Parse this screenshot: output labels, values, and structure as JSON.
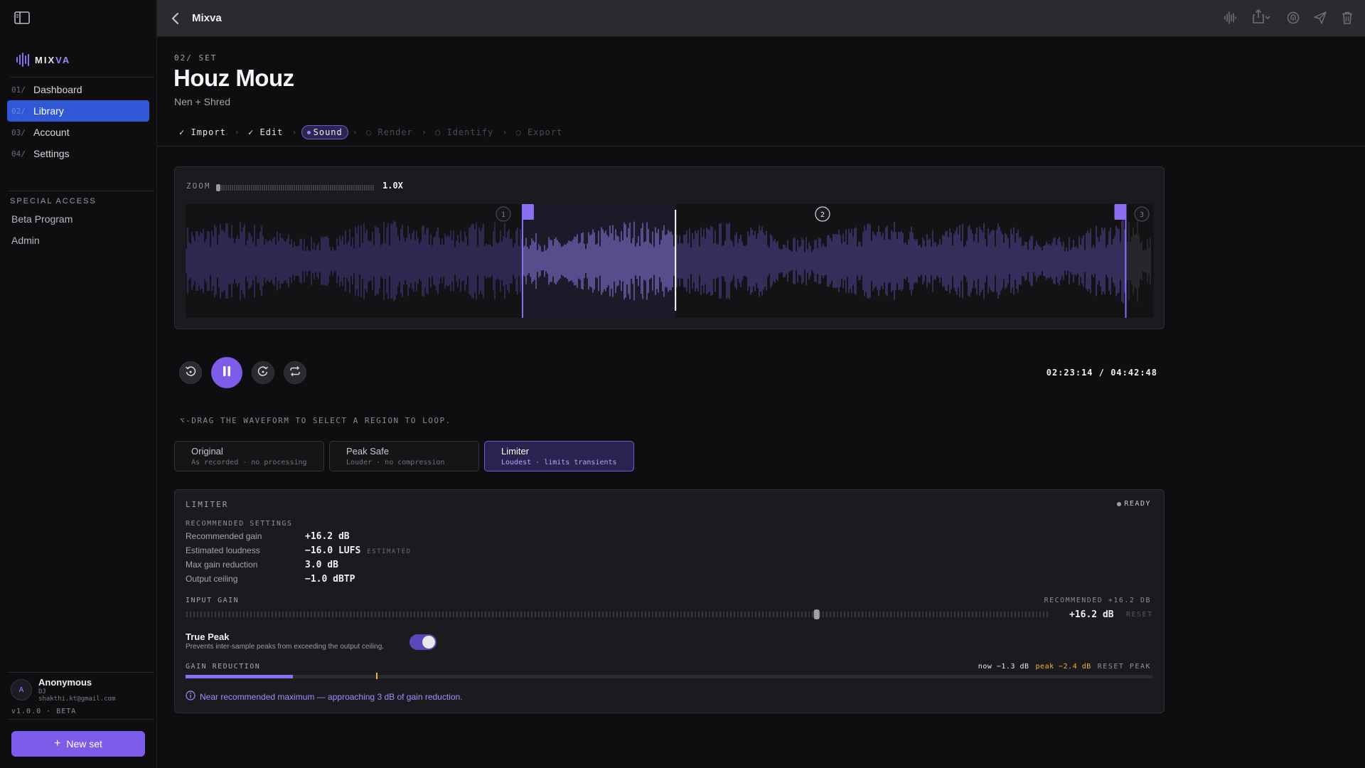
{
  "app": {
    "title": "Mixva"
  },
  "sidebar": {
    "logo_a": "MIX",
    "logo_b": "VA",
    "nav": [
      {
        "num": "01/",
        "label": "Dashboard",
        "active": false
      },
      {
        "num": "02/",
        "label": "Library",
        "active": true
      },
      {
        "num": "03/",
        "label": "Account",
        "active": false
      },
      {
        "num": "04/",
        "label": "Settings",
        "active": false
      }
    ],
    "special_title": "SPECIAL ACCESS",
    "special_items": [
      "Beta Program",
      "Admin"
    ],
    "user": {
      "initial": "A",
      "name": "Anonymous",
      "role": "DJ",
      "email": "shakthi.kt@gmail.com"
    },
    "version": "v1.0.0 · BETA",
    "new_set": "New set"
  },
  "topbar": {
    "title": "Mixva",
    "icons": [
      "waveform-icon",
      "share-icon",
      "chevron-down-icon",
      "fingerprint-icon",
      "send-icon",
      "trash-icon"
    ]
  },
  "set": {
    "kicker": "02/ SET",
    "title": "Houz Mouz",
    "subtitle": "Nen + Shred"
  },
  "steps": [
    {
      "label": "✓ Import",
      "state": "done"
    },
    {
      "label": "✓ Edit",
      "state": "done"
    },
    {
      "label": "Sound",
      "state": "current"
    },
    {
      "label": "○ Render",
      "state": "disabled"
    },
    {
      "label": "○ Identify",
      "state": "disabled"
    },
    {
      "label": "○ Export",
      "state": "disabled"
    }
  ],
  "waveform": {
    "zoom_label": "ZOOM",
    "zoom_value": "1.0X",
    "markers": [
      "1",
      "2",
      "3"
    ],
    "playhead_fraction": 0.506,
    "loop_start_fraction": 0.348,
    "loop_end_fraction": 0.971
  },
  "transport": {
    "time": "02:23:14 / 04:42:48",
    "hint": "⌥-DRAG THE WAVEFORM TO SELECT A REGION TO LOOP."
  },
  "modes": [
    {
      "title": "Original",
      "sub": "As recorded · no processing",
      "active": false
    },
    {
      "title": "Peak Safe",
      "sub": "Louder · no compression",
      "active": false
    },
    {
      "title": "Limiter",
      "sub": "Loudest · limits transients",
      "active": true
    }
  ],
  "limiter": {
    "title": "LIMITER",
    "status": "READY",
    "rec_title": "RECOMMENDED SETTINGS",
    "rows": [
      {
        "k": "Recommended gain",
        "v": "+16.2 dB",
        "tag": ""
      },
      {
        "k": "Estimated loudness",
        "v": "−16.0 LUFS",
        "tag": "ESTIMATED"
      },
      {
        "k": "Max gain reduction",
        "v": "3.0 dB",
        "tag": ""
      },
      {
        "k": "Output ceiling",
        "v": "−1.0 dBTP",
        "tag": ""
      }
    ],
    "input_gain": {
      "title": "INPUT GAIN",
      "recommended": "RECOMMENDED +16.2 DB",
      "value": "+16.2 dB",
      "reset": "RESET",
      "fraction": 0.73
    },
    "true_peak": {
      "title": "True Peak",
      "sub": "Prevents inter-sample peaks from exceeding the output ceiling.",
      "on": true
    },
    "gain_reduction": {
      "title": "GAIN REDUCTION",
      "now": "now −1.3 dB",
      "peak": "peak −2.4 dB",
      "reset_peak": "RESET PEAK",
      "now_fraction": 0.111,
      "peak_fraction": 0.197
    },
    "warning": "Near recommended maximum — approaching 3 dB of gain reduction.",
    "colors": {
      "accent": "#7c5ce8",
      "peak": "#f0b43a",
      "nav_active": "#2f57d6"
    }
  }
}
